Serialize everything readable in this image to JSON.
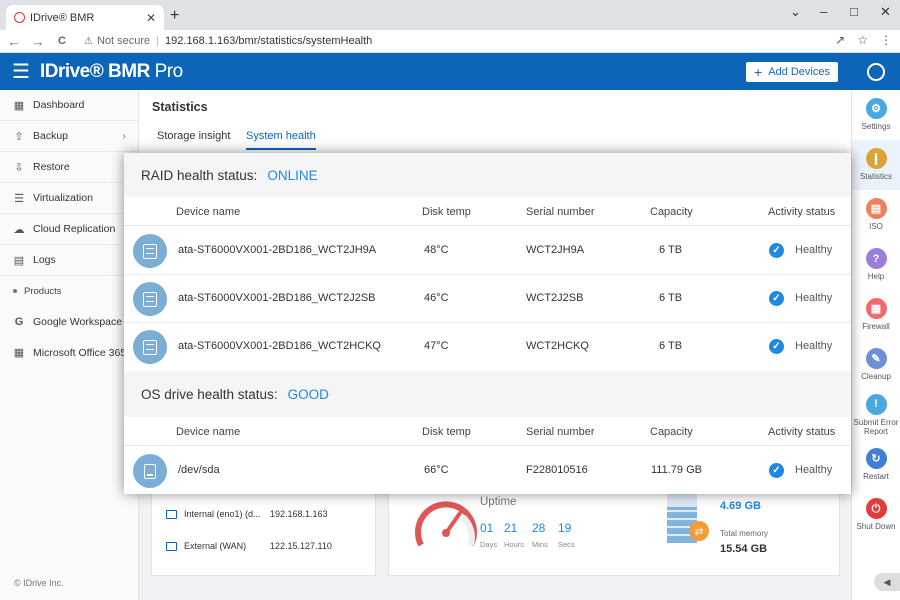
{
  "browser": {
    "tab_title": "IDrive® BMR",
    "new_tab": "+",
    "not_secure": "Not secure",
    "url": "192.168.1.163/bmr/statistics/systemHealth",
    "min": "–",
    "restore": "□",
    "close": "✕",
    "back": "←",
    "forward": "→",
    "reload": "C"
  },
  "app": {
    "brand_main": "IDrive® BMR",
    "brand_pro": " Pro",
    "add_devices": "Add Devices"
  },
  "sidebar": {
    "items": [
      {
        "label": "Dashboard",
        "icon": "dashboard-icon"
      },
      {
        "label": "Backup",
        "icon": "backup-icon"
      },
      {
        "label": "Restore",
        "icon": "restore-icon"
      },
      {
        "label": "Virtualization",
        "icon": "virtualization-icon"
      },
      {
        "label": "Cloud Replication",
        "icon": "cloud-icon"
      },
      {
        "label": "Logs",
        "icon": "logs-icon"
      }
    ],
    "products_label": "Products",
    "products": [
      {
        "label": "Google Workspace",
        "icon": "google-icon"
      },
      {
        "label": "Microsoft Office 365",
        "icon": "microsoft-icon"
      }
    ],
    "copyright": "© IDrive Inc."
  },
  "right_sidebar": {
    "items": [
      {
        "label": "Settings",
        "color": "#4aa8e0",
        "glyph": "⚙"
      },
      {
        "label": "Statistics",
        "color": "#d9a53a",
        "glyph": "❙"
      },
      {
        "label": "ISO",
        "color": "#f07f5b",
        "glyph": "▤"
      },
      {
        "label": "Help",
        "color": "#9a7fd6",
        "glyph": "?"
      },
      {
        "label": "Firewall",
        "color": "#ef6a6a",
        "glyph": "▦"
      },
      {
        "label": "Cleanup",
        "color": "#6c8fd6",
        "glyph": "✎"
      },
      {
        "label": "Submit Error Report",
        "color": "#4aa8e0",
        "glyph": "!"
      },
      {
        "label": "Restart",
        "color": "#3f7fd6",
        "glyph": "↻"
      },
      {
        "label": "Shut Down",
        "color": "#e23b3b",
        "glyph": "⏻"
      }
    ]
  },
  "statistics": {
    "title": "Statistics",
    "tabs": [
      "Storage insight",
      "System health"
    ]
  },
  "network": {
    "rows": [
      {
        "label": "Internal (eno1) (d...",
        "ip": "192.168.1.163"
      },
      {
        "label": "External (WAN)",
        "ip": "122.15.127.110"
      }
    ]
  },
  "uptime": {
    "label": "Uptime",
    "values": [
      {
        "num": "01",
        "unit": "Days"
      },
      {
        "num": "21",
        "unit": "Hours"
      },
      {
        "num": "28",
        "unit": "Mins"
      },
      {
        "num": "19",
        "unit": "Secs"
      }
    ]
  },
  "memory": {
    "used": "4.69 GB",
    "total_label": "Total memory",
    "total": "15.54 GB"
  },
  "raid": {
    "label": "RAID health status:",
    "status": "ONLINE",
    "columns": [
      "Device name",
      "Disk temp",
      "Serial number",
      "Capacity",
      "Activity status"
    ],
    "rows": [
      {
        "name": "ata-ST6000VX001-2BD186_WCT2JH9A",
        "temp": "48°C",
        "serial": "WCT2JH9A",
        "capacity": "6 TB",
        "status": "Healthy"
      },
      {
        "name": "ata-ST6000VX001-2BD186_WCT2J2SB",
        "temp": "46°C",
        "serial": "WCT2J2SB",
        "capacity": "6 TB",
        "status": "Healthy"
      },
      {
        "name": "ata-ST6000VX001-2BD186_WCT2HCKQ",
        "temp": "47°C",
        "serial": "WCT2HCKQ",
        "capacity": "6 TB",
        "status": "Healthy"
      }
    ]
  },
  "os_drive": {
    "label": "OS drive health status:",
    "status": "GOOD",
    "columns": [
      "Device name",
      "Disk temp",
      "Serial number",
      "Capacity",
      "Activity status"
    ],
    "rows": [
      {
        "name": "/dev/sda",
        "temp": "66°C",
        "serial": "F228010516",
        "capacity": "111.79 GB",
        "status": "Healthy"
      }
    ]
  }
}
